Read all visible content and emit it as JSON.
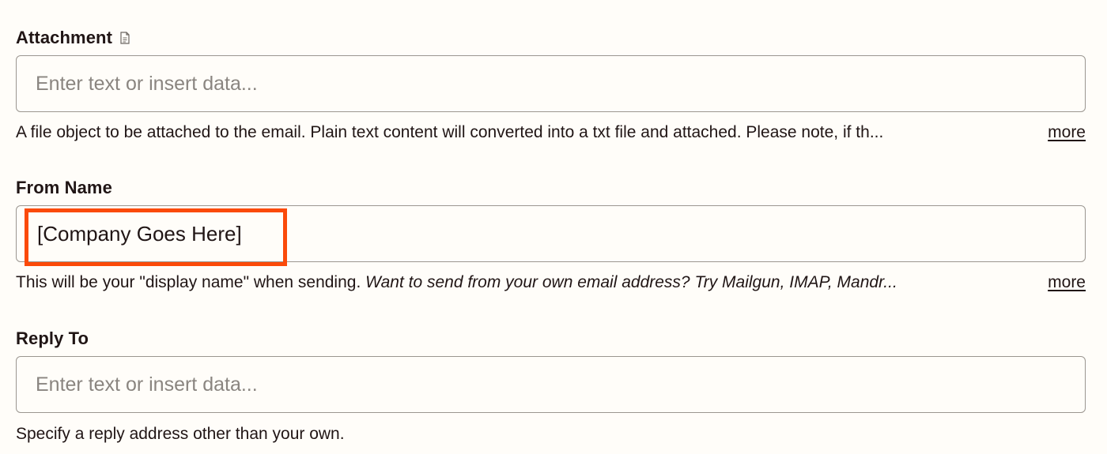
{
  "fields": {
    "attachment": {
      "label": "Attachment",
      "icon": "file-icon",
      "placeholder": "Enter text or insert data...",
      "help": "A file object to be attached to the email. Plain text content will converted into a txt file and attached. Please note, if th...",
      "more": "more"
    },
    "from_name": {
      "label": "From Name",
      "value": "[Company Goes Here]",
      "help_plain": "This will be your \"display name\" when sending. ",
      "help_italic": "Want to send from your own email address? Try Mailgun, IMAP, Mandr...",
      "more": "more"
    },
    "reply_to": {
      "label": "Reply To",
      "placeholder": "Enter text or insert data...",
      "help": "Specify a reply address other than your own."
    }
  },
  "colors": {
    "background": "#fffdf9",
    "text": "#201515",
    "placeholder": "#8a8580",
    "border": "#9b9690",
    "highlight": "#fb4a0a"
  }
}
